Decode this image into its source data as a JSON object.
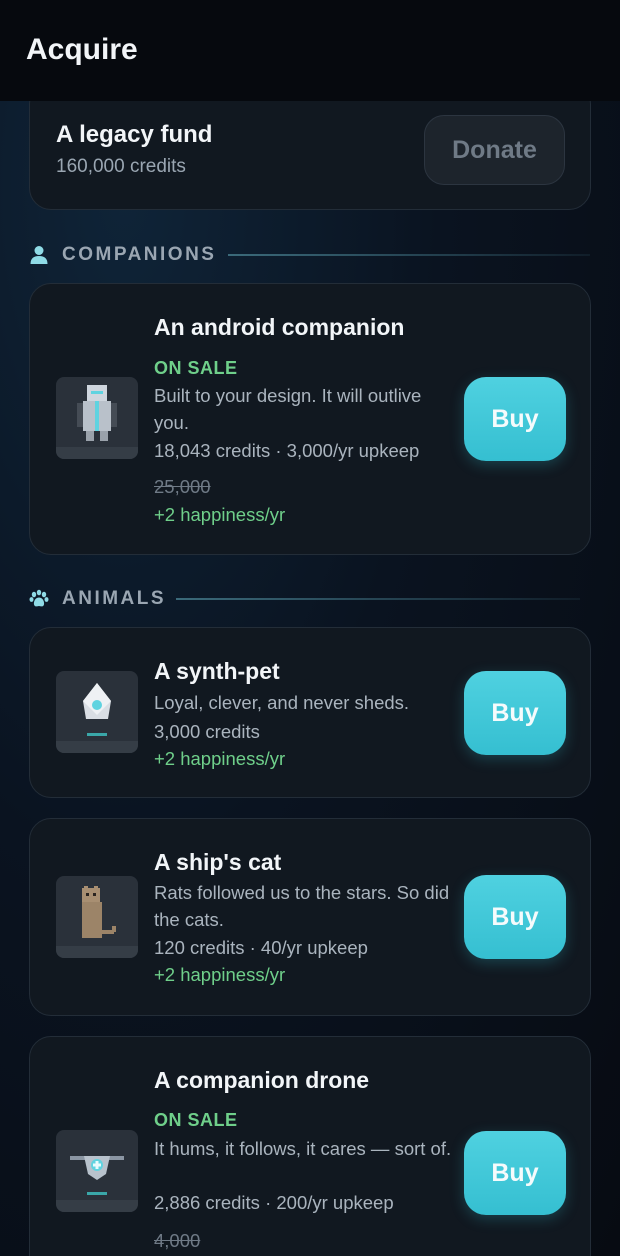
{
  "header": {
    "title": "Acquire"
  },
  "legacy": {
    "name": "A legacy fund",
    "amount": "160,000 credits",
    "donate_label": "Donate"
  },
  "sections": {
    "companions": {
      "label": "COMPANIONS",
      "icon": "person-icon"
    },
    "animals": {
      "label": "ANIMALS",
      "icon": "paw-icon"
    }
  },
  "items": [
    {
      "title": "An android companion",
      "sale": "ON SALE",
      "desc": "Built to your design. It will outlive you.",
      "cost": "18,043 credits · 3,000/yr upkeep",
      "orig": "25,000",
      "happy": "+2 happiness/yr",
      "buy_label": "Buy",
      "icon": "android-icon"
    },
    {
      "title": "A synth-pet",
      "desc": "Loyal, clever, and never sheds.",
      "cost": "3,000 credits",
      "happy": "+2 happiness/yr",
      "buy_label": "Buy",
      "icon": "synth-pet-icon"
    },
    {
      "title": "A ship's cat",
      "desc": "Rats followed us to the stars. So did the cats.",
      "cost": "120 credits · 40/yr upkeep",
      "happy": "+2 happiness/yr",
      "buy_label": "Buy",
      "icon": "cat-icon"
    },
    {
      "title": "A companion drone",
      "sale": "ON SALE",
      "desc": "It hums, it follows, it cares — sort of.",
      "cost": "2,886 credits · 200/yr upkeep",
      "orig": "4,000",
      "buy_label": "Buy",
      "icon": "drone-icon"
    }
  ],
  "colors": {
    "accent": "#35bfd1",
    "sale": "#6fcf8a",
    "background": "#0a1320",
    "card": "#111820"
  }
}
